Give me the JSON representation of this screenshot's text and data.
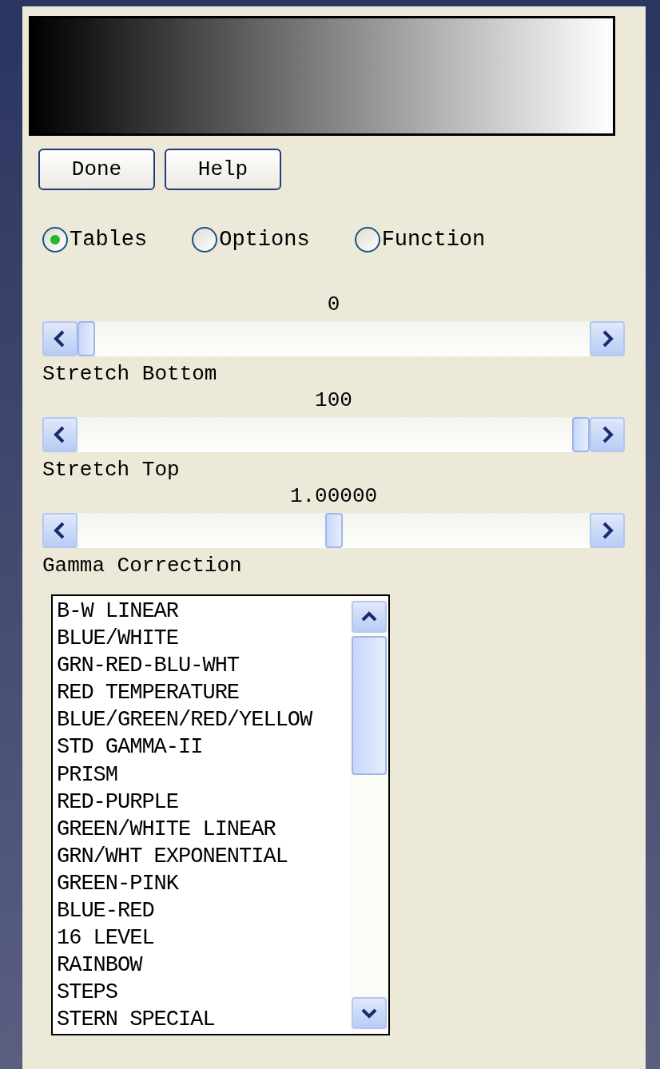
{
  "buttons": [
    "Done",
    "Help"
  ],
  "modes": [
    {
      "label": "Tables",
      "selected": true
    },
    {
      "label": "Options",
      "selected": false
    },
    {
      "label": "Function",
      "selected": false
    }
  ],
  "sliders": [
    {
      "reading": "0",
      "level": 0,
      "label": "Stretch Bottom"
    },
    {
      "reading": "100",
      "level": 1,
      "label": "Stretch Top"
    },
    {
      "reading": "1.00000",
      "level": 0.5,
      "label": "Gamma Correction"
    }
  ],
  "table_list": {
    "items": [
      {
        "label": "B-W LINEAR",
        "selected": false
      },
      {
        "label": "BLUE/WHITE",
        "selected": false
      },
      {
        "label": "GRN-RED-BLU-WHT",
        "selected": false
      },
      {
        "label": "RED TEMPERATURE",
        "selected": false
      },
      {
        "label": "BLUE/GREEN/RED/YELLOW",
        "selected": false
      },
      {
        "label": "STD GAMMA-II",
        "selected": false
      },
      {
        "label": "PRISM",
        "selected": false
      },
      {
        "label": "RED-PURPLE",
        "selected": false
      },
      {
        "label": "GREEN/WHITE LINEAR",
        "selected": false
      },
      {
        "label": "GRN/WHT EXPONENTIAL",
        "selected": false
      },
      {
        "label": "GREEN-PINK",
        "selected": false
      },
      {
        "label": "BLUE-RED",
        "selected": false
      },
      {
        "label": "16 LEVEL",
        "selected": false
      },
      {
        "label": "RAINBOW",
        "selected": false
      },
      {
        "label": "STEPS",
        "selected": false
      },
      {
        "label": "STERN SPECIAL",
        "selected": false
      }
    ]
  }
}
